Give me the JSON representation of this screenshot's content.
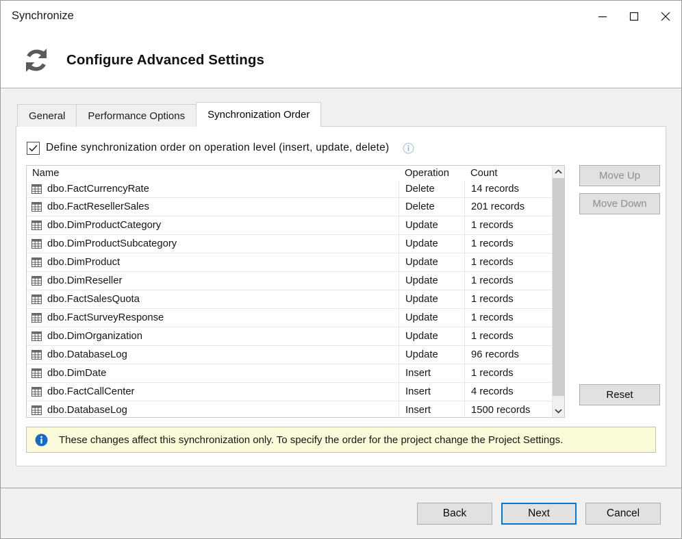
{
  "window": {
    "title": "Synchronize",
    "caption_buttons": [
      {
        "name": "minimize",
        "label": "Minimize"
      },
      {
        "name": "maximize",
        "label": "Maximize"
      },
      {
        "name": "close",
        "label": "Close"
      }
    ]
  },
  "header": {
    "icon": "sync-icon",
    "title": "Configure Advanced Settings"
  },
  "tabs": [
    {
      "label": "General",
      "active": false
    },
    {
      "label": "Performance Options",
      "active": false
    },
    {
      "label": "Synchronization Order",
      "active": true
    }
  ],
  "options": {
    "checkbox_label": "Define synchronization order on operation level (insert, update, delete)",
    "checkbox_checked": true,
    "info_icon": "info-circle-icon"
  },
  "grid": {
    "columns": [
      "Name",
      "Operation",
      "Count"
    ],
    "rows": [
      {
        "name": "dbo.FactCurrencyRate",
        "operation": "Delete",
        "count": "14 records"
      },
      {
        "name": "dbo.FactResellerSales",
        "operation": "Delete",
        "count": "201 records"
      },
      {
        "name": "dbo.DimProductCategory",
        "operation": "Update",
        "count": "1 records"
      },
      {
        "name": "dbo.DimProductSubcategory",
        "operation": "Update",
        "count": "1 records"
      },
      {
        "name": "dbo.DimProduct",
        "operation": "Update",
        "count": "1 records"
      },
      {
        "name": "dbo.DimReseller",
        "operation": "Update",
        "count": "1 records"
      },
      {
        "name": "dbo.FactSalesQuota",
        "operation": "Update",
        "count": "1 records"
      },
      {
        "name": "dbo.FactSurveyResponse",
        "operation": "Update",
        "count": "1 records"
      },
      {
        "name": "dbo.DimOrganization",
        "operation": "Update",
        "count": "1 records"
      },
      {
        "name": "dbo.DatabaseLog",
        "operation": "Update",
        "count": "96 records"
      },
      {
        "name": "dbo.DimDate",
        "operation": "Insert",
        "count": "1 records"
      },
      {
        "name": "dbo.FactCallCenter",
        "operation": "Insert",
        "count": "4 records"
      },
      {
        "name": "dbo.DatabaseLog",
        "operation": "Insert",
        "count": "1500 records"
      }
    ],
    "scrollbar": {
      "up_icon": "chevron-up-icon",
      "down_icon": "chevron-down-icon"
    }
  },
  "side_buttons": {
    "move_up": {
      "label": "Move Up",
      "enabled": false
    },
    "move_down": {
      "label": "Move Down",
      "enabled": false
    },
    "reset": {
      "label": "Reset",
      "enabled": true
    }
  },
  "banner": {
    "icon": "info-icon",
    "text": "These changes affect this synchronization only. To specify the order for the project change the Project Settings.",
    "background": "#fbfbd9"
  },
  "footer": {
    "back": "Back",
    "next": "Next",
    "cancel": "Cancel",
    "default_button": "Next",
    "focus_color": "#0078d7"
  }
}
